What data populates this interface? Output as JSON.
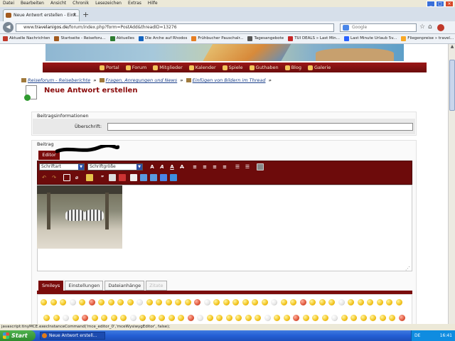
{
  "menubar": {
    "items": [
      "Datei",
      "Bearbeiten",
      "Ansicht",
      "Chronik",
      "Lesezeichen",
      "Extras",
      "Hilfe"
    ]
  },
  "browser": {
    "tab_title": "Neue Antwort erstellen - Einf...",
    "new_tab": "+",
    "url_prefix": "www.",
    "url_domain": "travelanigos.de",
    "url_path": "/forum/index.php?form=PostAdd&threadID=13276",
    "search_placeholder": "Google",
    "back_icon": "back-arrow-icon",
    "forward_icon": "forward-arrow-icon"
  },
  "bookmarks": [
    {
      "label": "Aktuelle Nachrichten",
      "color": "#c0392b"
    },
    {
      "label": "Startseite - Reiseforu...",
      "color": "#a25a1e"
    },
    {
      "label": "Aktuelles",
      "color": "#2e7d32"
    },
    {
      "label": "Die Arche auf Rhodos",
      "color": "#1565c0"
    },
    {
      "label": "Frühbucher Pauschalr...",
      "color": "#e67e22"
    },
    {
      "label": "Tagesangebote",
      "color": "#555555"
    },
    {
      "label": "TUI DEALS » Last Min...",
      "color": "#c62828"
    },
    {
      "label": "Last Minute Urlaub 5v...",
      "color": "#2962ff"
    },
    {
      "label": "Fliegenpreise » travel...",
      "color": "#f9a825"
    }
  ],
  "site_nav": [
    "Portal",
    "Forum",
    "Mitglieder",
    "Kalender",
    "Spiele",
    "Guthaben",
    "Blog",
    "Galerie"
  ],
  "breadcrumb": [
    "Reiseforum - Reiseberichte",
    "Fragen, Anregungen und News",
    "Einfügen von Bildern im Thread"
  ],
  "breadcrumb_sep": "»",
  "page_title": "Neue Antwort erstellen",
  "form": {
    "info_legend": "Beitragsinformationen",
    "heading_label": "Überschrift:",
    "heading_value": "",
    "post_legend": "Beitrag",
    "editor_tab": "Editor",
    "font_select": "Schriftart",
    "size_select": "Schriftgröße",
    "subtabs": [
      "Smileys",
      "Einstellungen",
      "Dateianhänge",
      "Zitate"
    ]
  },
  "status_text": "javascript:tinyMCE.execInstanceCommand('mce_editor_0','mceWysiwygEditor', false);",
  "taskbar": {
    "start_label": "Start",
    "task_label": "Neue Antwort erstell...",
    "lang": "DE",
    "time": "16:41"
  },
  "colors": {
    "accent": "#7a0c0c",
    "title": "#8a0b0b",
    "link": "#1a3f8a"
  }
}
